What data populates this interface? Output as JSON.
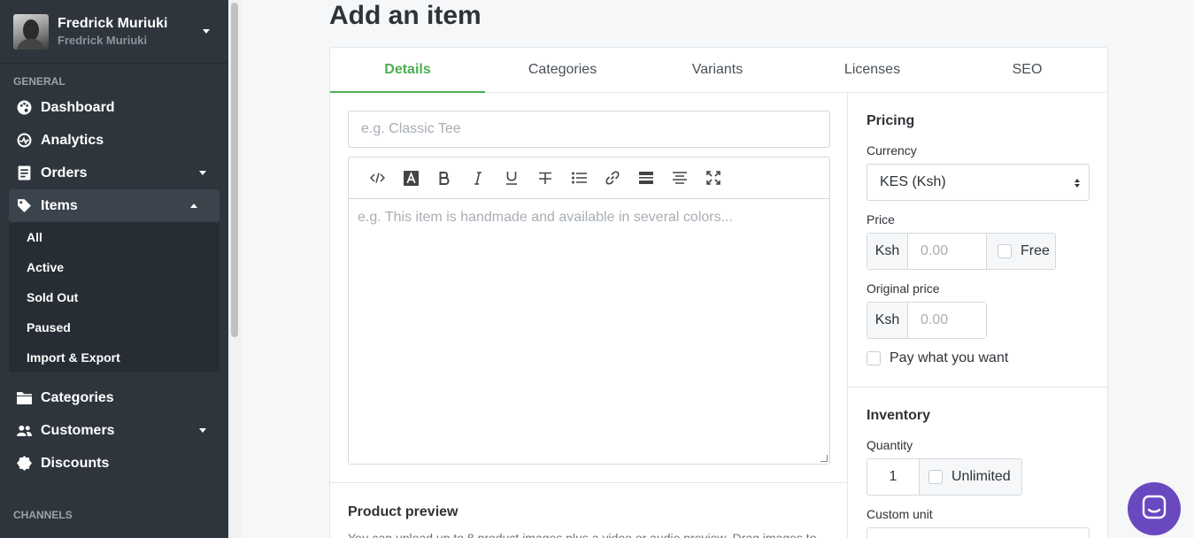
{
  "user": {
    "name": "Fredrick Muriuki",
    "subtitle": "Fredrick Muriuki"
  },
  "sidebar": {
    "general_label": "GENERAL",
    "channels_label": "CHANNELS",
    "items": [
      {
        "label": "Dashboard",
        "icon": "palette-icon"
      },
      {
        "label": "Analytics",
        "icon": "gauge-icon"
      },
      {
        "label": "Orders",
        "icon": "receipt-icon"
      },
      {
        "label": "Items",
        "icon": "tag-icon"
      },
      {
        "label": "Categories",
        "icon": "folder-icon"
      },
      {
        "label": "Customers",
        "icon": "users-icon"
      },
      {
        "label": "Discounts",
        "icon": "badge-icon"
      }
    ],
    "items_sub": [
      "All",
      "Active",
      "Sold Out",
      "Paused",
      "Import & Export"
    ]
  },
  "page": {
    "title": "Add an item"
  },
  "tabs": [
    "Details",
    "Categories",
    "Variants",
    "Licenses",
    "SEO"
  ],
  "details": {
    "title_placeholder": "e.g. Classic Tee",
    "description_placeholder": "e.g. This item is handmade and available in several colors...",
    "toolbar": [
      "code-icon",
      "text-color-icon",
      "bold-icon",
      "italic-icon",
      "underline-icon",
      "strikethrough-icon",
      "bullet-list-icon",
      "link-icon",
      "horizontal-rule-icon",
      "align-center-icon",
      "fullscreen-icon"
    ],
    "preview_title": "Product preview",
    "preview_text": "You can upload up to 8 product images plus a video or audio preview. Drag images to"
  },
  "pricing": {
    "title": "Pricing",
    "currency_label": "Currency",
    "currency_value": "KES (Ksh)",
    "price_label": "Price",
    "currency_symbol": "Ksh",
    "price_placeholder": "0.00",
    "free_label": "Free",
    "original_price_label": "Original price",
    "original_price_placeholder": "0.00",
    "pay_what_you_want_label": "Pay what you want"
  },
  "inventory": {
    "title": "Inventory",
    "quantity_label": "Quantity",
    "quantity_value": "1",
    "unlimited_label": "Unlimited",
    "custom_unit_label": "Custom unit"
  },
  "colors": {
    "accent": "#4caf50",
    "sidebar_bg": "#2e353d",
    "chat": "#6a48c0"
  }
}
